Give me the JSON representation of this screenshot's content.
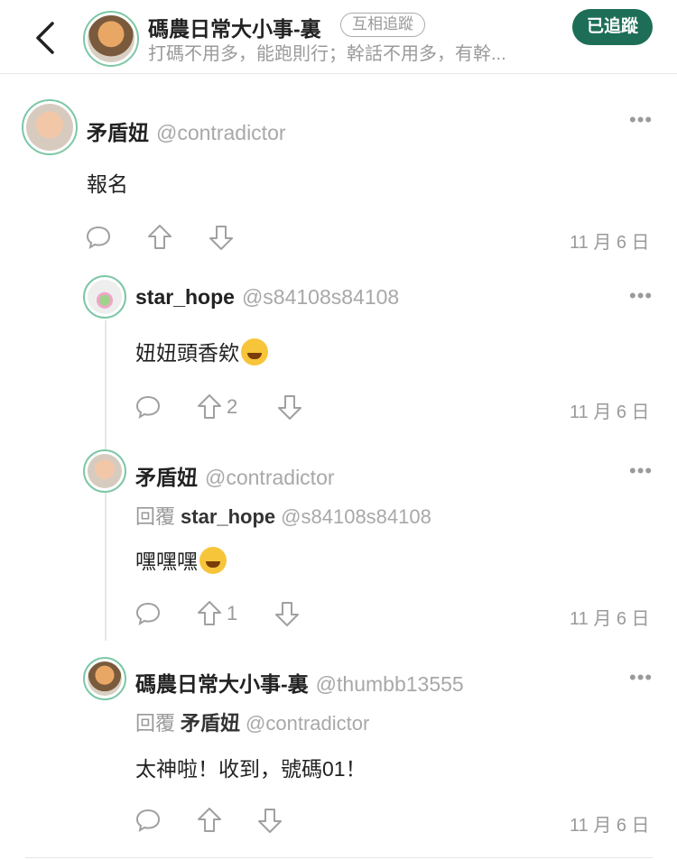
{
  "header": {
    "title": "碼農日常大小事-裏",
    "mutual_badge": "互相追蹤",
    "subtitle": "打碼不用多，能跑則行；幹話不用多，有幹...",
    "follow_button": "已追蹤"
  },
  "comments": [
    {
      "name": "矛盾妞",
      "handle": "@contradictor",
      "text": "報名",
      "upvotes": "",
      "date": "11 月 6 日"
    },
    {
      "name": "star_hope",
      "handle": "@s84108s84108",
      "text": "妞妞頭香欸",
      "upvotes": "2",
      "date": "11 月 6 日"
    },
    {
      "name": "矛盾妞",
      "handle": "@contradictor",
      "reply_label": "回覆",
      "reply_name": "star_hope",
      "reply_handle": "@s84108s84108",
      "text": "嘿嘿嘿",
      "upvotes": "1",
      "date": "11 月 6 日"
    },
    {
      "name": "碼農日常大小事-裏",
      "handle": "@thumbb13555",
      "reply_label": "回覆",
      "reply_name": "矛盾妞",
      "reply_handle": "@contradictor",
      "text": "太神啦！收到，號碼01！",
      "upvotes": "",
      "date": "11 月 6 日"
    }
  ],
  "icons": {
    "back": "chevron-left-icon",
    "more": "more-dots-icon",
    "comment": "comment-bubble-icon",
    "upvote": "arrow-up-icon",
    "downvote": "arrow-down-icon",
    "emoji_laugh": "tears-of-joy-emoji",
    "emoji_grin": "grinning-emoji"
  },
  "colors": {
    "accent": "#1e6e57",
    "avatar_ring": "#7cc7a6",
    "muted_text": "#9a9a9a"
  }
}
